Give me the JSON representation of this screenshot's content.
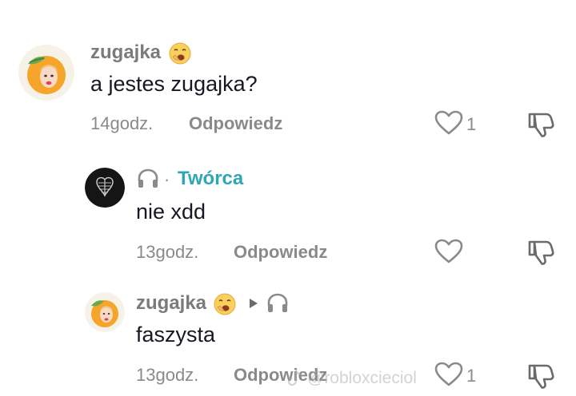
{
  "comments": [
    {
      "username": "zugajka",
      "text": "a jestes zugajka?",
      "time": "14godz.",
      "reply_label": "Odpowiedz",
      "likes": "1",
      "emoji_icon": "yawning-face-emoji-icon",
      "avatar_icon": "orange-girl-avatar"
    },
    {
      "creator_label": "Twórca",
      "creator_separator": "·",
      "text": "nie xdd",
      "time": "13godz.",
      "reply_label": "Odpowiedz",
      "badge_icon": "headphones-icon",
      "avatar_icon": "ribcage-heart-avatar"
    },
    {
      "username": "zugajka",
      "text": "faszysta",
      "time": "13godz.",
      "reply_label": "Odpowiedz",
      "likes": "1",
      "emoji_icon": "yawning-face-emoji-icon",
      "reply_to_icon": "headphones-icon",
      "avatar_icon": "orange-girl-avatar"
    }
  ],
  "watermark": "@robloxcieciol",
  "colors": {
    "creator": "#2fa6b8",
    "text": "#161823",
    "muted": "#8a8a8a",
    "avatar_orange": "#f4a52a"
  }
}
